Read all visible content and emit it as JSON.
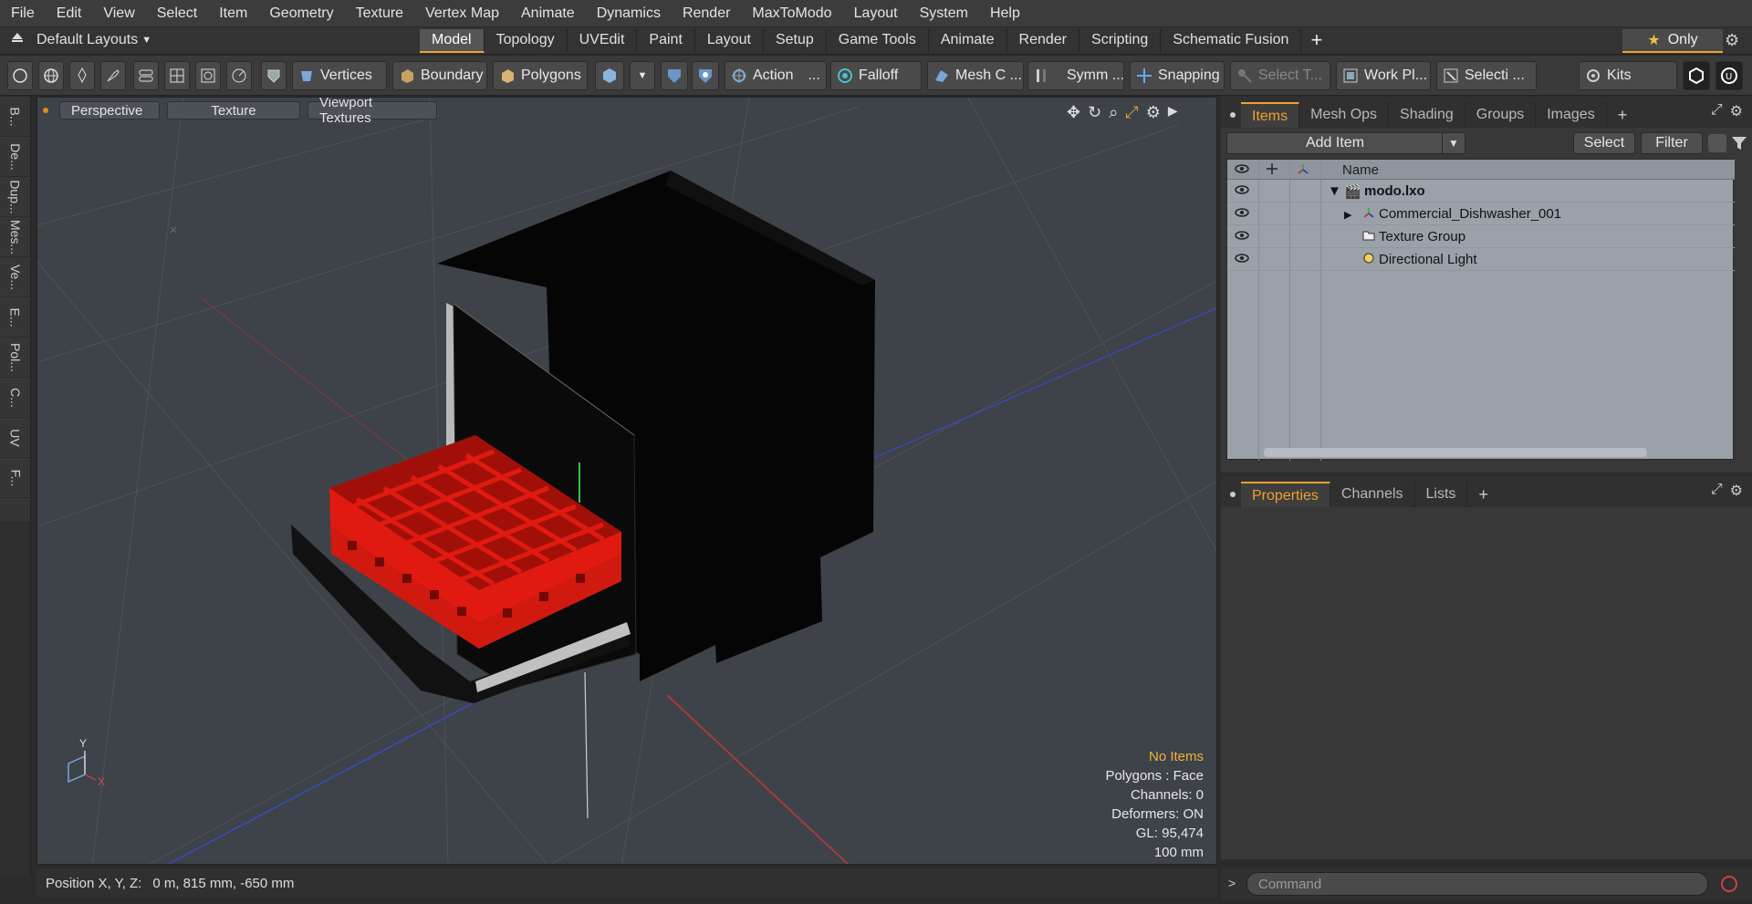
{
  "menubar": {
    "items": [
      "File",
      "Edit",
      "View",
      "Select",
      "Item",
      "Geometry",
      "Texture",
      "Vertex Map",
      "Animate",
      "Dynamics",
      "Render",
      "MaxToModo",
      "Layout",
      "System",
      "Help"
    ]
  },
  "layout_bar": {
    "layouts_label": "Default Layouts",
    "tabs": [
      "Model",
      "Topology",
      "UVEdit",
      "Paint",
      "Layout",
      "Setup",
      "Game Tools",
      "Animate",
      "Render",
      "Scripting",
      "Schematic Fusion"
    ],
    "active_tab": "Model",
    "only_label": "Only"
  },
  "toolbar": {
    "vertices": "Vertices",
    "boundary": "Boundary",
    "polygons": "Polygons",
    "action": "Action",
    "falloff": "Falloff",
    "mesh": "Mesh C ...",
    "symmetry": "Symm ...",
    "snapping": "Snapping",
    "select_t": "Select T...",
    "work_plane": "Work Pl...",
    "selection": "Selecti ...",
    "kits": "Kits"
  },
  "left_strip": {
    "tabs": [
      "B...",
      "De...",
      "Dup...",
      "Mes...",
      "Ve...",
      "E...",
      "Pol...",
      "C...",
      "UV",
      "F..."
    ]
  },
  "viewport": {
    "view_mode": "Perspective",
    "shading": "Texture",
    "textures": "Viewport Textures",
    "stats": {
      "items": "No Items",
      "polygons": "Polygons : Face",
      "channels": "Channels: 0",
      "deformers": "Deformers: ON",
      "gl": "GL: 95,474",
      "unit": "100 mm"
    },
    "axis": {
      "x": "X",
      "y": "Y"
    },
    "colors": {
      "background": "#3d4349",
      "rack": "#e01a10",
      "body": "#050505",
      "grid": "#4c5258"
    }
  },
  "status": {
    "position_label": "Position X, Y, Z:",
    "position_value": "0 m, 815 mm, -650 mm"
  },
  "items_panel": {
    "tabs": [
      "Items",
      "Mesh Ops",
      "Shading",
      "Groups",
      "Images"
    ],
    "active_tab": "Items",
    "add_item": "Add Item",
    "select": "Select",
    "filter": "Filter",
    "name_header": "Name",
    "tree": [
      {
        "label": "modo.lxo",
        "bold": true
      },
      {
        "label": "Commercial_Dishwasher_001"
      },
      {
        "label": "Texture Group"
      },
      {
        "label": "Directional Light"
      }
    ]
  },
  "props_panel": {
    "tabs": [
      "Properties",
      "Channels",
      "Lists"
    ],
    "active_tab": "Properties"
  },
  "command": {
    "placeholder": "Command"
  },
  "colors": {
    "accent": "#f0a030"
  }
}
